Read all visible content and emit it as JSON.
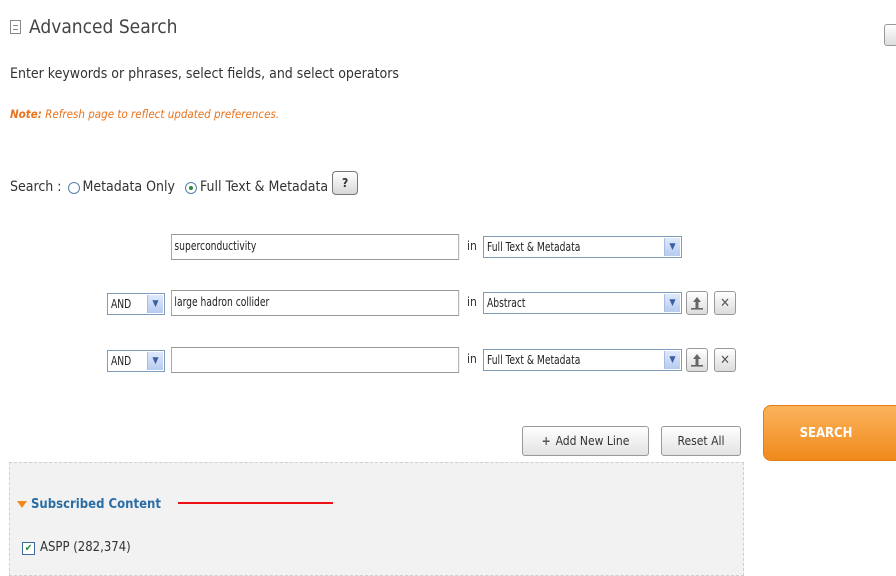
{
  "header": {
    "title": "Advanced Search",
    "subtitle": "Enter keywords or phrases, select fields, and select operators",
    "note_label": "Note:",
    "note_text": "Refresh page to reflect updated preferences."
  },
  "search_mode": {
    "label": "Search :",
    "options": [
      "Metadata Only",
      "Full Text & Metadata"
    ],
    "selected": "Full Text & Metadata",
    "help_label": "?"
  },
  "query_rows": [
    {
      "operator": "",
      "term": "superconductivity",
      "in_label": "in",
      "field": "Full Text & Metadata"
    },
    {
      "operator": "AND",
      "term": "large hadron collider",
      "in_label": "in",
      "field": "Abstract"
    },
    {
      "operator": "AND",
      "term": "",
      "in_label": "in",
      "field": "Full Text & Metadata"
    }
  ],
  "actions": {
    "add_line_label": "Add New Line",
    "reset_label": "Reset All",
    "search_label": "SEARCH"
  },
  "subscribed": {
    "title": "Subscribed Content",
    "items": [
      {
        "label": "ASPP (282,374)",
        "checked": true
      }
    ]
  },
  "icons": {
    "move_up": "move-up-icon",
    "remove": "remove-icon",
    "add": "add-line-icon",
    "dropdown": "chevron-down-icon"
  },
  "colors": {
    "accent_orange": "#f08a1c",
    "link_blue": "#2b6ea6",
    "note_orange": "#e8731c",
    "annotation_red": "#e11111"
  }
}
